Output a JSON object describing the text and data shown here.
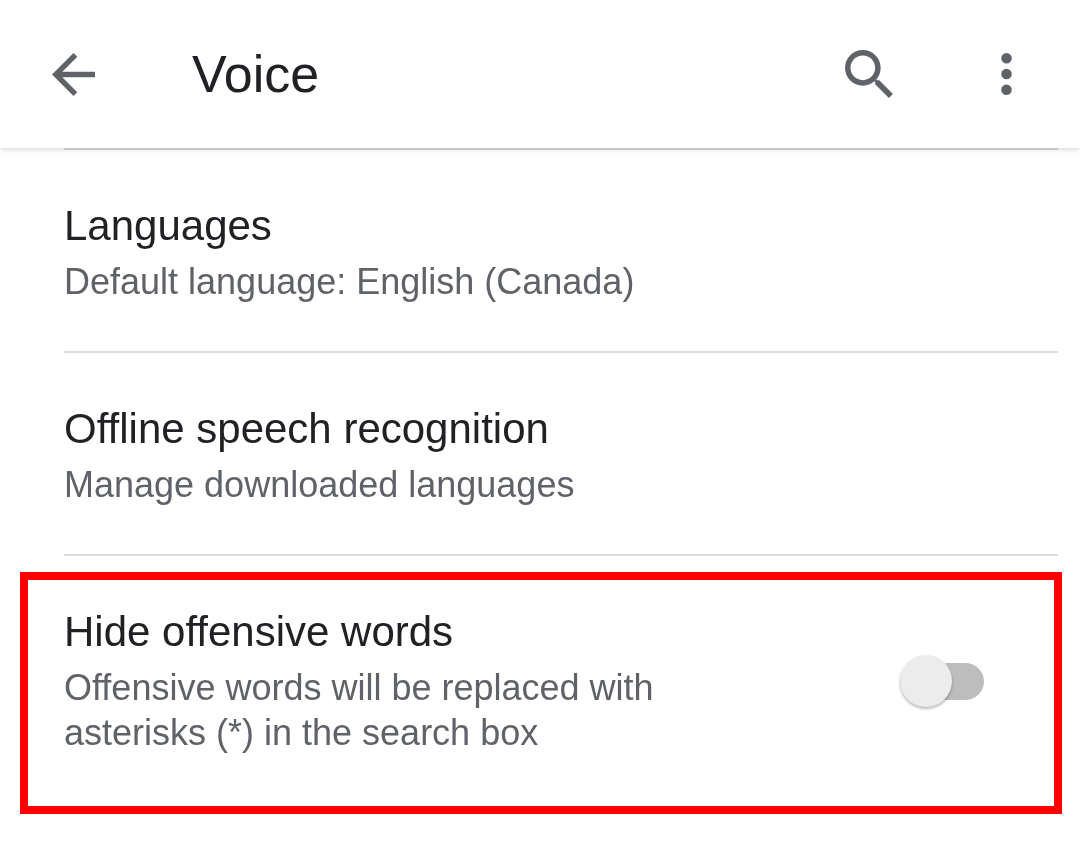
{
  "app_bar": {
    "title": "Voice"
  },
  "settings": [
    {
      "kind": "link",
      "title": "Languages",
      "summary": "Default language: English (Canada)",
      "highlighted": false
    },
    {
      "kind": "link",
      "title": "Offline speech recognition",
      "summary": "Manage downloaded languages",
      "highlighted": false
    },
    {
      "kind": "switch",
      "title": "Hide offensive words",
      "summary": "Offensive words will be replaced with asterisks (*) in the search box",
      "on": false,
      "highlighted": true
    }
  ]
}
